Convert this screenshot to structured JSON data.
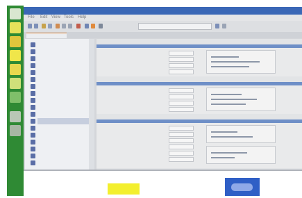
{
  "app": {
    "title": "",
    "menu": [
      "File",
      "Edit",
      "View",
      "Tools",
      "Help"
    ],
    "address": "",
    "tabs": [
      "",
      "",
      "",
      ""
    ]
  },
  "tree": {
    "items": [
      "",
      "",
      "",
      "",
      "",
      "",
      "",
      "",
      "",
      "",
      "",
      "",
      "",
      "",
      "",
      "",
      "",
      ""
    ]
  },
  "colors": {
    "launcher": "#2f8a34",
    "titlebar": "#3a67b6",
    "section_header": "#6e8fc7",
    "note": "#f3ef2e",
    "thumb": "#2f5fc6"
  }
}
